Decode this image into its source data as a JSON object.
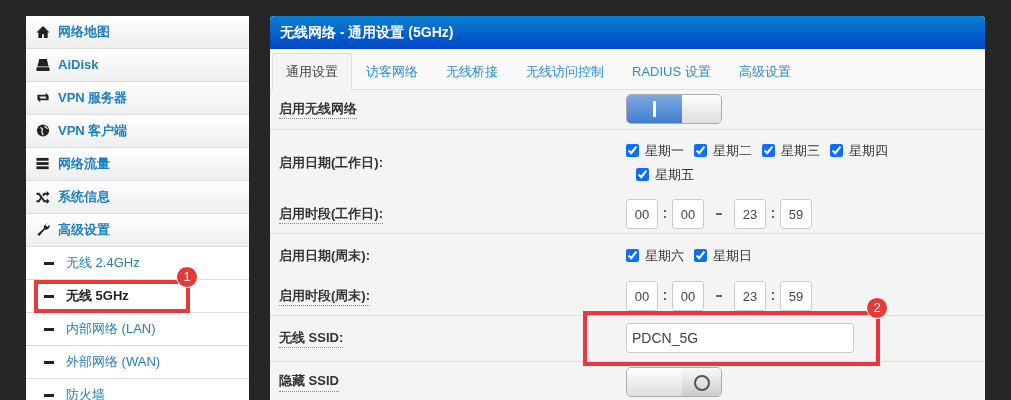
{
  "sidebar": {
    "items": [
      {
        "label": "网络地图",
        "selected": false
      },
      {
        "label": "AiDisk",
        "selected": false
      },
      {
        "label": "VPN 服务器",
        "selected": false
      },
      {
        "label": "VPN 客户端",
        "selected": false
      },
      {
        "label": "网络流量",
        "selected": false
      },
      {
        "label": "系统信息",
        "selected": false
      },
      {
        "label": "高级设置",
        "selected": false,
        "children": [
          {
            "label": "无线 2.4GHz",
            "selected": false
          },
          {
            "label": "无线 5GHz",
            "selected": true,
            "annotation": "1"
          },
          {
            "label": "内部网络 (LAN)",
            "selected": false
          },
          {
            "label": "外部网络 (WAN)",
            "selected": false
          },
          {
            "label": "防火墙",
            "selected": false
          }
        ]
      }
    ]
  },
  "panel": {
    "title": "无线网络 - 通用设置 (5GHz)",
    "tabs": [
      {
        "label": "通用设置",
        "selected": true
      },
      {
        "label": "访客网络",
        "selected": false
      },
      {
        "label": "无线桥接",
        "selected": false
      },
      {
        "label": "无线访问控制",
        "selected": false
      },
      {
        "label": "RADIUS 设置",
        "selected": false
      },
      {
        "label": "高级设置",
        "selected": false
      }
    ],
    "rows": [
      {
        "kind": "switch",
        "label": "启用无线网络",
        "on": true
      },
      {
        "kind": "days",
        "label": "启用日期(工作日):",
        "days": [
          {
            "label": "星期一",
            "checked": true
          },
          {
            "label": "星期二",
            "checked": true
          },
          {
            "label": "星期三",
            "checked": true
          },
          {
            "label": "星期四",
            "checked": true
          },
          {
            "label": "星期五",
            "checked": true
          }
        ]
      },
      {
        "kind": "time",
        "label": "启用时段(工作日):",
        "from_hour": "00",
        "from_minute": "00",
        "to_hour": "23",
        "to_minute": "59"
      },
      {
        "kind": "days",
        "label": "启用日期(周末):",
        "days": [
          {
            "label": "星期六",
            "checked": true
          },
          {
            "label": "星期日",
            "checked": true
          }
        ]
      },
      {
        "kind": "time",
        "label": "启用时段(周末):",
        "from_hour": "00",
        "from_minute": "00",
        "to_hour": "23",
        "to_minute": "59"
      },
      {
        "kind": "text",
        "label": "无线 SSID:",
        "value": "PDCN_5G",
        "annotation": "2"
      },
      {
        "kind": "switch",
        "label": "隐藏 SSID",
        "on": false
      }
    ]
  }
}
